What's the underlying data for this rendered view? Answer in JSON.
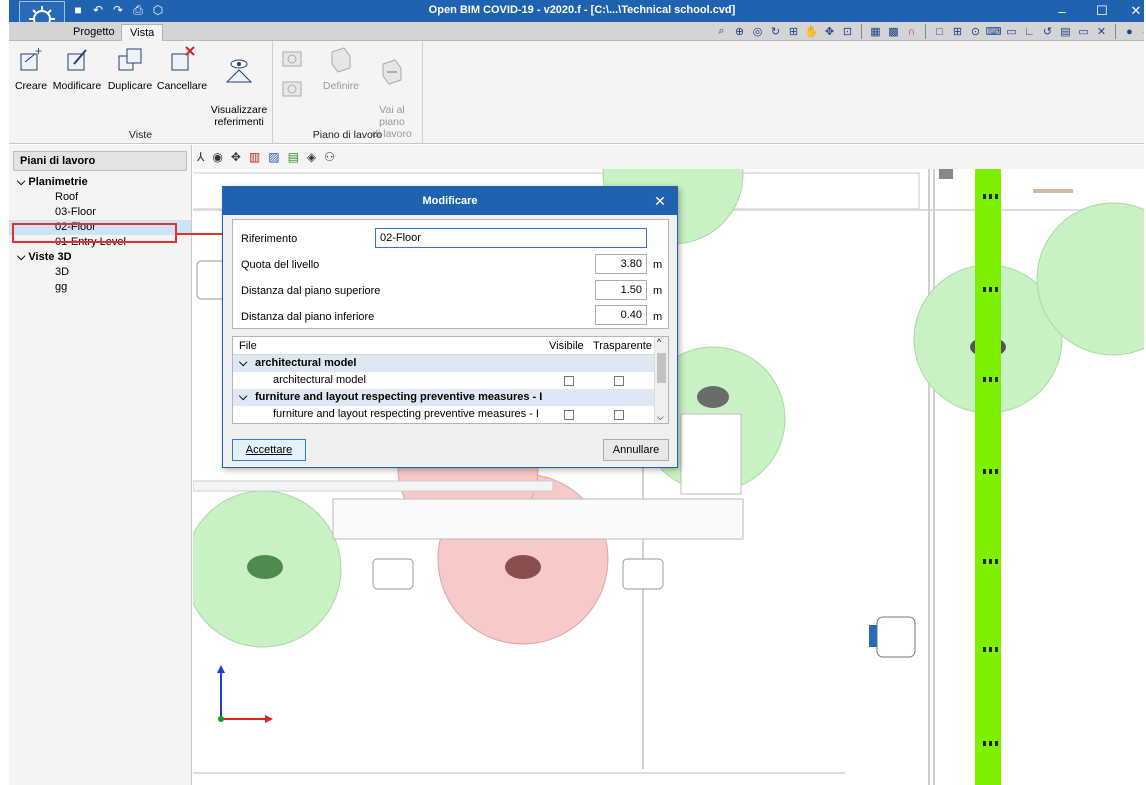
{
  "window": {
    "title": "Open BIM COVID-19 - v2020.f - [C:\\...\\Technical school.cvd]",
    "minimize": "–",
    "maximize": "☐",
    "close": "✕"
  },
  "tabs": [
    {
      "label": "Progetto",
      "active": false
    },
    {
      "label": "Vista",
      "active": true
    }
  ],
  "ribbon": {
    "groups": [
      {
        "label": "Viste",
        "buttons": [
          "Creare",
          "Modificare",
          "Duplicare",
          "Cancellare",
          "Visualizzare\nreferimenti"
        ]
      },
      {
        "label": "Piano di lavoro",
        "buttons": [
          "Definire",
          "Vai al piano\ndi lavoro"
        ]
      }
    ]
  },
  "sidebar": {
    "header": "Piani di lavoro",
    "tree": [
      {
        "label": "Planimetrie",
        "type": "group"
      },
      {
        "label": "Roof",
        "type": "leaf"
      },
      {
        "label": "03-Floor",
        "type": "leaf"
      },
      {
        "label": "02-Floor",
        "type": "leaf",
        "selected": true
      },
      {
        "label": "01-Entry Level",
        "type": "leaf"
      },
      {
        "label": "Viste 3D",
        "type": "group"
      },
      {
        "label": "3D",
        "type": "leaf"
      },
      {
        "label": "gg",
        "type": "leaf"
      }
    ]
  },
  "dialog": {
    "title": "Modificare",
    "close": "✕",
    "fields": {
      "riferimento_label": "Riferimento",
      "riferimento_value": "02-Floor",
      "quota_label": "Quota del livello",
      "quota_value": "3.80",
      "sup_label": "Distanza dal piano superiore",
      "sup_value": "1.50",
      "inf_label": "Distanza dal piano inferiore",
      "inf_value": "0.40",
      "unit": "m"
    },
    "files": {
      "col_file": "File",
      "col_visible": "Visibile",
      "col_trasparente": "Trasparente",
      "rows": [
        {
          "label": "architectural model",
          "type": "group"
        },
        {
          "label": "architectural model",
          "type": "item"
        },
        {
          "label": "furniture and layout respecting preventive measures - I",
          "type": "group"
        },
        {
          "label": "furniture and layout respecting preventive measures - I",
          "type": "item"
        }
      ]
    },
    "ok": "Accettare",
    "cancel": "Annullare"
  },
  "colors": {
    "titlebar": "#1e62b0",
    "accent": "#2a7bd8",
    "highlight": "#e53030",
    "corridor": "#7df000",
    "zone_green": "#c9f2c4",
    "zone_red": "#f7c9c9"
  },
  "icons": {
    "save": "💾",
    "undo": "↶",
    "redo": "↷"
  }
}
